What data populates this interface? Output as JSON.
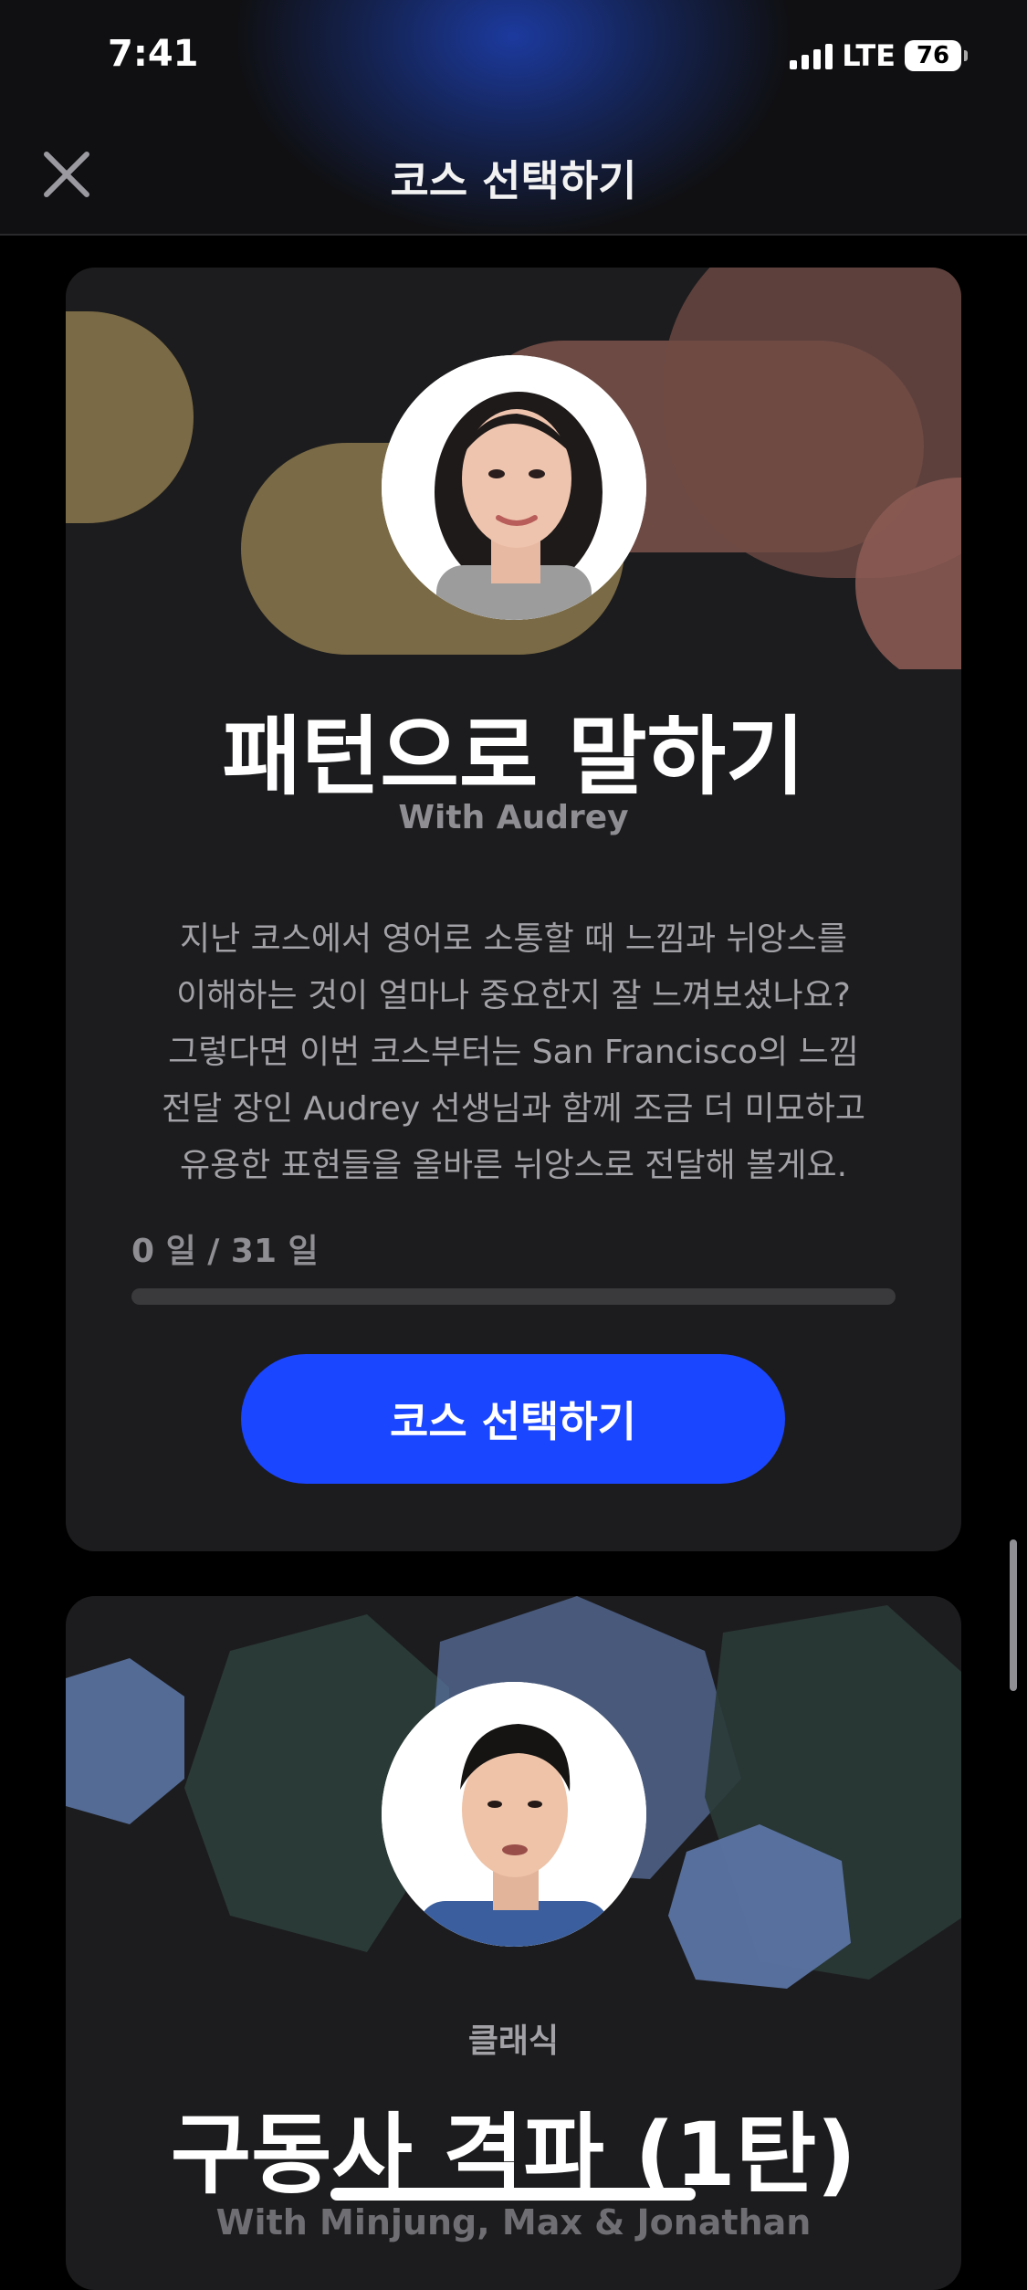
{
  "status_bar": {
    "time": "7:41",
    "network": "LTE",
    "battery": "76"
  },
  "nav": {
    "title": "코스 선택하기",
    "close_icon": "close-icon"
  },
  "courses": [
    {
      "title": "패턴으로 말하기",
      "instructor": "With Audrey",
      "description_lines": [
        "지난 코스에서 영어로 소통할 때 느낌과 뉘앙스를",
        "이해하는 것이 얼마나 중요한지 잘 느껴보셨나요?",
        "그렇다면 이번 코스부터는 San Francisco의 느낌",
        "전달 장인 Audrey 선생님과 함께 조금 더 미묘하고",
        "유용한 표현들을 올바른 뉘앙스로 전달해 볼게요."
      ],
      "progress_label": "0 일 / 31 일",
      "progress": 0,
      "button_label": "코스 선택하기",
      "colors": {
        "accent": "#1b46ff",
        "deco_gold": "#7a6a45",
        "deco_rose": "#8a5a52"
      }
    },
    {
      "category": "클래식",
      "title": "구동사 격파 (1탄)",
      "instructor": "With Minjung, Max & Jonathan",
      "colors": {
        "deco_blue": "#5b74a3",
        "deco_teal": "#2a3a36"
      }
    }
  ]
}
